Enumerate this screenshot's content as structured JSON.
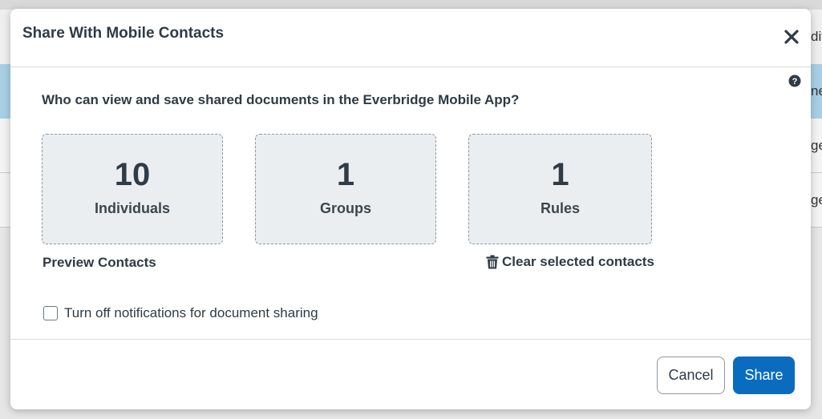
{
  "background": {
    "header_fragment": "dif",
    "row_fragments": [
      "ne",
      "ge",
      "ge"
    ]
  },
  "modal": {
    "title": "Share With Mobile Contacts",
    "close_icon": "close-icon",
    "help_icon": "help-circle-icon",
    "question": "Who can view and save shared documents in the Everbridge Mobile App?",
    "counts": [
      {
        "value": "10",
        "label": "Individuals"
      },
      {
        "value": "1",
        "label": "Groups"
      },
      {
        "value": "1",
        "label": "Rules"
      }
    ],
    "preview_link": "Preview Contacts",
    "clear_link": "Clear selected contacts",
    "clear_icon": "trash-icon",
    "notification_checkbox": {
      "label": "Turn off notifications for document sharing",
      "checked": false
    },
    "buttons": {
      "cancel": "Cancel",
      "share": "Share"
    },
    "colors": {
      "primary": "#0a6cbf",
      "box_bg": "#ebeef1",
      "selected_row": "#a9cfe6"
    }
  }
}
